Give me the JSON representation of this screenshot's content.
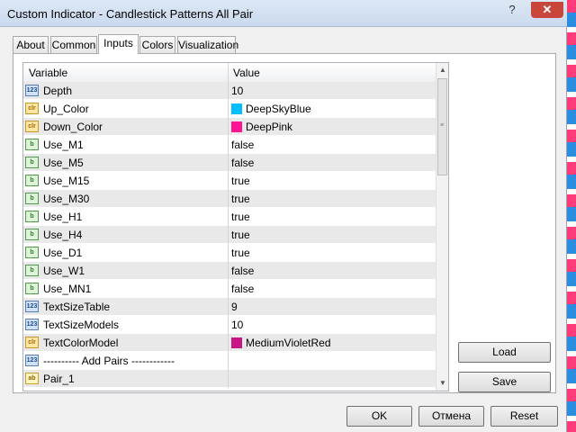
{
  "window": {
    "title": "Custom Indicator - Candlestick Patterns All Pair",
    "help_glyph": "?",
    "close_glyph": "✕"
  },
  "tabs": [
    {
      "label": "About"
    },
    {
      "label": "Common"
    },
    {
      "label": "Inputs"
    },
    {
      "label": "Colors"
    },
    {
      "label": "Visualization"
    }
  ],
  "active_tab": "Inputs",
  "grid": {
    "headers": {
      "variable": "Variable",
      "value": "Value"
    },
    "rows": [
      {
        "icon": "123",
        "type": "int",
        "name": "Depth",
        "value": "10"
      },
      {
        "icon": "clr",
        "type": "color",
        "name": "Up_Color",
        "value": "DeepSkyBlue",
        "swatch": "#00bfff"
      },
      {
        "icon": "clr",
        "type": "color",
        "name": "Down_Color",
        "value": "DeepPink",
        "swatch": "#ff1493"
      },
      {
        "icon": "b",
        "type": "bool",
        "name": "Use_M1",
        "value": "false"
      },
      {
        "icon": "b",
        "type": "bool",
        "name": "Use_M5",
        "value": "false"
      },
      {
        "icon": "b",
        "type": "bool",
        "name": "Use_M15",
        "value": "true"
      },
      {
        "icon": "b",
        "type": "bool",
        "name": "Use_M30",
        "value": "true"
      },
      {
        "icon": "b",
        "type": "bool",
        "name": "Use_H1",
        "value": "true"
      },
      {
        "icon": "b",
        "type": "bool",
        "name": "Use_H4",
        "value": "true"
      },
      {
        "icon": "b",
        "type": "bool",
        "name": "Use_D1",
        "value": "true"
      },
      {
        "icon": "b",
        "type": "bool",
        "name": "Use_W1",
        "value": "false"
      },
      {
        "icon": "b",
        "type": "bool",
        "name": "Use_MN1",
        "value": "false"
      },
      {
        "icon": "123",
        "type": "int",
        "name": "TextSizeTable",
        "value": "9"
      },
      {
        "icon": "123",
        "type": "int",
        "name": "TextSizeModels",
        "value": "10"
      },
      {
        "icon": "clr",
        "type": "color",
        "name": "TextColorModel",
        "value": "MediumVioletRed",
        "swatch": "#c71585"
      },
      {
        "icon": "123",
        "type": "int",
        "name": "---------- Add Pairs ------------",
        "value": ""
      },
      {
        "icon": "ab",
        "type": "string",
        "name": "Pair_1",
        "value": ""
      }
    ]
  },
  "buttons": {
    "load": "Load",
    "save": "Save",
    "ok": "OK",
    "cancel": "Отмена",
    "reset": "Reset"
  },
  "colors": {
    "titlebar": "#c9d9ee",
    "close": "#c9463d",
    "accent_pink": "#ff1493",
    "accent_blue": "#00bfff"
  }
}
